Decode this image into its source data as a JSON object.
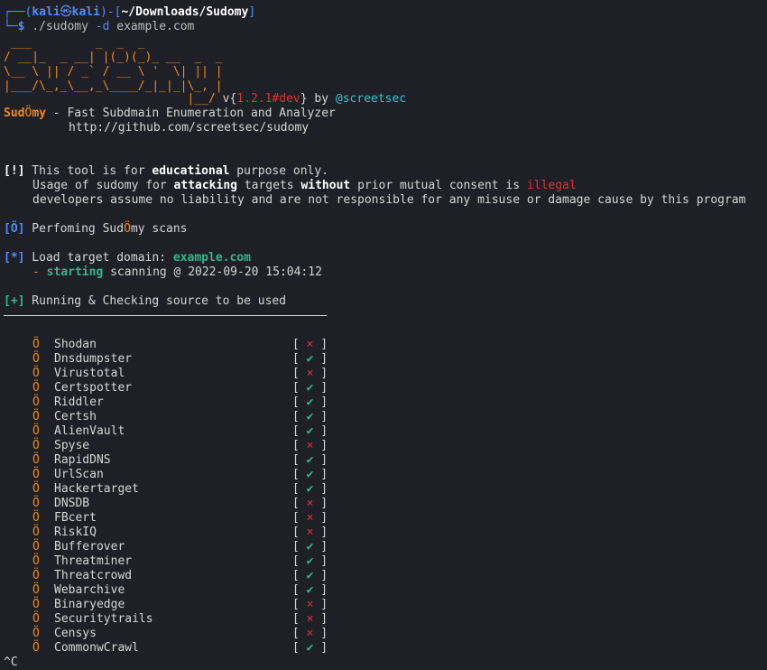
{
  "prompt": {
    "line1_prefix": "┌──(",
    "user": "kali",
    "at": "㉿",
    "host": "kali",
    "mid": ")-[",
    "path": "~/Downloads/Sudomy",
    "end": "]",
    "line2_prefix": "└─",
    "dollar": "$",
    "cmd": "./sudomy",
    "flag": "-d",
    "arg": "example.com"
  },
  "banner": {
    "art": [
      " ___         _  _  _",
      "/ __|_  _ __| |(_)(_)_ __  _  _",
      "\\__ \\ || / _` / __ \\ '  \\| || |",
      "|___/\\_,_\\__,_\\____/_|_|_|\\_, |",
      "                          |__/"
    ],
    "version_prefix": " v{",
    "version": "1.2.1#dev",
    "version_suffix": "}",
    "by": " by ",
    "author": "@screetsec",
    "name_part1": "Sud",
    "name_o": "Ö",
    "name_part2": "my",
    "tagline": " - Fast Subdmain Enumeration and Analyzer",
    "url": "http://github.com/screetsec/sudomy"
  },
  "notice": {
    "tag": "[!]",
    "l1a": " This tool is for ",
    "l1b": "educational",
    "l1c": " purpose only.",
    "l2a": "Usage of sudomy for ",
    "l2b": "attacking",
    "l2c": " targets ",
    "l2d": "without",
    "l2e": " prior mutual consent is ",
    "l2f": "illegal",
    "l3": "developers assume no liability and are not responsible for any misuse or damage cause by this program"
  },
  "scan": {
    "tag": "[Ö]",
    "text_a": " Perfoming Sud",
    "text_o": "Ö",
    "text_b": "my scans"
  },
  "target": {
    "tag": "[*]",
    "label": " Load target domain: ",
    "domain": "example.com",
    "dash": "- ",
    "starting": "starting",
    "rest": " scanning @ 2022-09-20 15:04:12"
  },
  "running": {
    "tag": "[+]",
    "text": " Running & Checking source to be used"
  },
  "sources": [
    {
      "name": "Shodan",
      "ok": false
    },
    {
      "name": "Dnsdumpster",
      "ok": true
    },
    {
      "name": "Virustotal",
      "ok": false
    },
    {
      "name": "Certspotter",
      "ok": true
    },
    {
      "name": "Riddler",
      "ok": true
    },
    {
      "name": "Certsh",
      "ok": true
    },
    {
      "name": "AlienVault",
      "ok": true
    },
    {
      "name": "Spyse",
      "ok": false
    },
    {
      "name": "RapidDNS",
      "ok": true
    },
    {
      "name": "UrlScan",
      "ok": true
    },
    {
      "name": "Hackertarget",
      "ok": true
    },
    {
      "name": "DNSDB",
      "ok": false
    },
    {
      "name": "FBcert",
      "ok": false
    },
    {
      "name": "RiskIQ",
      "ok": false
    },
    {
      "name": "Bufferover",
      "ok": true
    },
    {
      "name": "Threatminer",
      "ok": true
    },
    {
      "name": "Threatcrowd",
      "ok": true
    },
    {
      "name": "Webarchive",
      "ok": true
    },
    {
      "name": "Binaryedge",
      "ok": false
    },
    {
      "name": "Securitytrails",
      "ok": false
    },
    {
      "name": "Censys",
      "ok": false
    },
    {
      "name": "CommonwCrawl",
      "ok": true
    }
  ],
  "marks": {
    "ok": "✔",
    "fail": "×",
    "bullet": "Ö",
    "open": "[",
    "close": "]"
  },
  "colors": {
    "background": "#1f1f28",
    "accent": "#f08a1e",
    "ok": "#2fb88c",
    "fail": "#d4382f",
    "prompt": "#4f8cf5"
  }
}
